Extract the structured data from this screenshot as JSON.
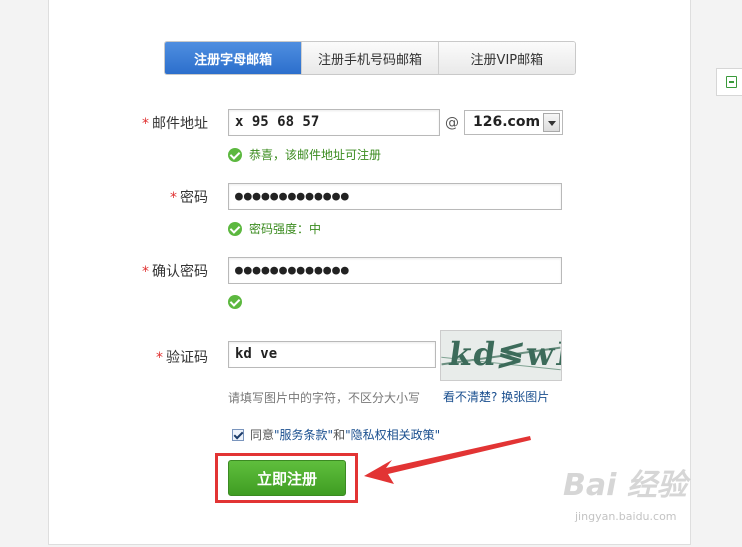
{
  "tabs": [
    {
      "label": "注册字母邮箱",
      "active": true
    },
    {
      "label": "注册手机号码邮箱",
      "active": false
    },
    {
      "label": "注册VIP邮箱",
      "active": false
    }
  ],
  "form": {
    "email": {
      "label": "邮件地址",
      "required_mark": "*",
      "value": "x  95  68  57",
      "at": "@",
      "domain": "126.com",
      "tip": "恭喜，该邮件地址可注册"
    },
    "password": {
      "label": "密码",
      "required_mark": "*",
      "value": "●●●●●●●●●●●●●",
      "tip": "密码强度：中"
    },
    "confirm": {
      "label": "确认密码",
      "required_mark": "*",
      "value": "●●●●●●●●●●●●●"
    },
    "captcha": {
      "label": "验证码",
      "required_mark": "*",
      "value": "kd  ve",
      "hint": "请填写图片中的字符，不区分大小写",
      "image_text": "kd≶wE",
      "link_prefix": "看不清楚?",
      "link": "换张图片"
    }
  },
  "agreement": {
    "prefix": "同意",
    "terms": "\"服务条款\"",
    "and": "和",
    "privacy": "\"隐私权相关政策\"",
    "checked": true
  },
  "submit_label": "立即注册",
  "colors": {
    "accent_blue": "#2c6fcc",
    "success_green": "#5cb83f",
    "highlight_red": "#e23434"
  },
  "watermark": {
    "logo": "Bai 经验",
    "url": "jingyan.baidu.com"
  }
}
